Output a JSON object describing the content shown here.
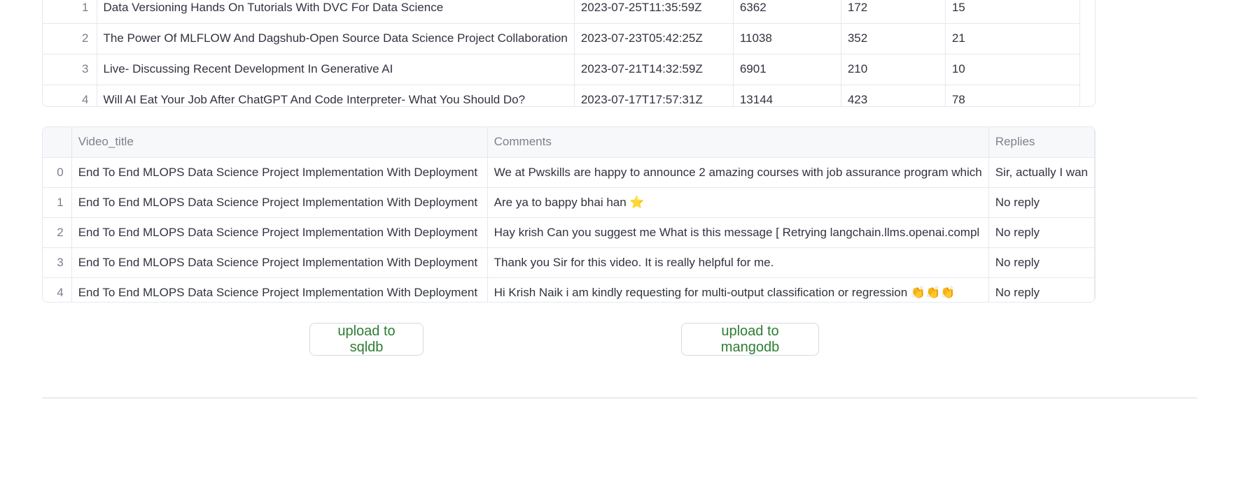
{
  "videos_table": {
    "rows": [
      {
        "index": "1",
        "title": "Data Versioning Hands On Tutorials With DVC For Data Science",
        "published": "2023-07-25T11:35:59Z",
        "views": "6362",
        "likes": "172",
        "comments": "15"
      },
      {
        "index": "2",
        "title": "The Power Of MLFLOW And Dagshub-Open Source Data Science Project Collaboration",
        "published": "2023-07-23T05:42:25Z",
        "views": "11038",
        "likes": "352",
        "comments": "21"
      },
      {
        "index": "3",
        "title": "Live- Discussing Recent Development In Generative AI",
        "published": "2023-07-21T14:32:59Z",
        "views": "6901",
        "likes": "210",
        "comments": "10"
      },
      {
        "index": "4",
        "title": "Will AI Eat Your Job After ChatGPT And Code Interpreter- What You Should Do?",
        "published": "2023-07-17T17:57:31Z",
        "views": "13144",
        "likes": "423",
        "comments": "78"
      }
    ]
  },
  "comments_table": {
    "headers": {
      "index": "",
      "video_title": "Video_title",
      "comments": "Comments",
      "replies": "Replies"
    },
    "rows": [
      {
        "index": "0",
        "video_title": "End To End MLOPS Data Science Project Implementation With Deployment",
        "comment": "We at Pwskills are happy to announce 2 amazing courses with job assurance program which",
        "reply": "Sir, actually I wan"
      },
      {
        "index": "1",
        "video_title": "End To End MLOPS Data Science Project Implementation With Deployment",
        "comment": "Are ya to bappy bhai han ⭐",
        "reply": "No reply"
      },
      {
        "index": "2",
        "video_title": "End To End MLOPS Data Science Project Implementation With Deployment",
        "comment": "Hay krish Can you suggest me What is this message  [ Retrying langchain.llms.openai.compl",
        "reply": "No reply"
      },
      {
        "index": "3",
        "video_title": "End To End MLOPS Data Science Project Implementation With Deployment",
        "comment": "Thank you Sir for this video. It is really helpful for me.",
        "reply": "No reply"
      },
      {
        "index": "4",
        "video_title": "End To End MLOPS Data Science Project Implementation With Deployment",
        "comment": "Hi Krish Naik i am kindly requesting for multi-output classification or regression 👏👏👏",
        "reply": "No reply"
      }
    ]
  },
  "buttons": {
    "upload_sql": "upload to sqldb",
    "upload_mongo": "upload to mangodb"
  },
  "colors": {
    "button_text": "#2e7d32",
    "border": "#e6e8ee",
    "header_bg": "#f7f8fa"
  }
}
